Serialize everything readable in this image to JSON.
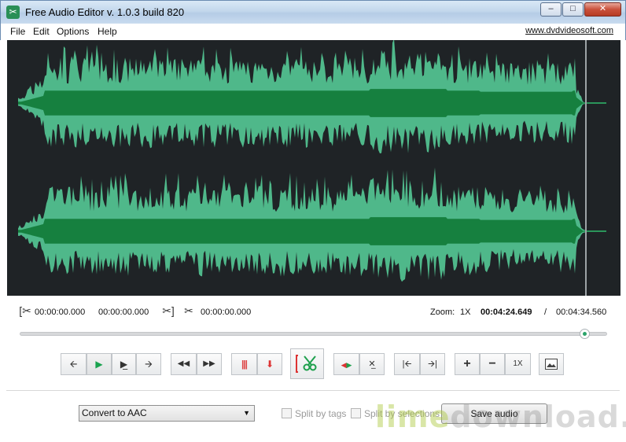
{
  "window": {
    "title": "Free Audio Editor v. 1.0.3 build 820",
    "min_label": "–",
    "max_label": "□",
    "close_label": "✕"
  },
  "menu": {
    "items": [
      "File",
      "Edit",
      "Options",
      "Help"
    ],
    "site_link": "www.dvdvideosoft.com"
  },
  "waveform": {
    "color_fill": "#4fb88a",
    "color_core": "#16803f",
    "background": "#1f2326"
  },
  "times": {
    "selection_start": "00:00:00.000",
    "selection_end": "00:00:00.000",
    "cut_time": "00:00:00.000",
    "zoom_label": "Zoom:",
    "zoom_value": "1X",
    "current": "00:04:24.649",
    "separator": "/",
    "total": "00:04:34.560"
  },
  "seek": {
    "position_fraction": 0.964
  },
  "toolbar": {
    "zoom_1x_label": "1X"
  },
  "bottom": {
    "format_select": "Convert to AAC",
    "split_by_tags": "Split by tags",
    "split_by_selections": "Split by selections",
    "save_label": "Save audio"
  },
  "watermark": {
    "lime": "lime",
    "rest": "download.com"
  }
}
